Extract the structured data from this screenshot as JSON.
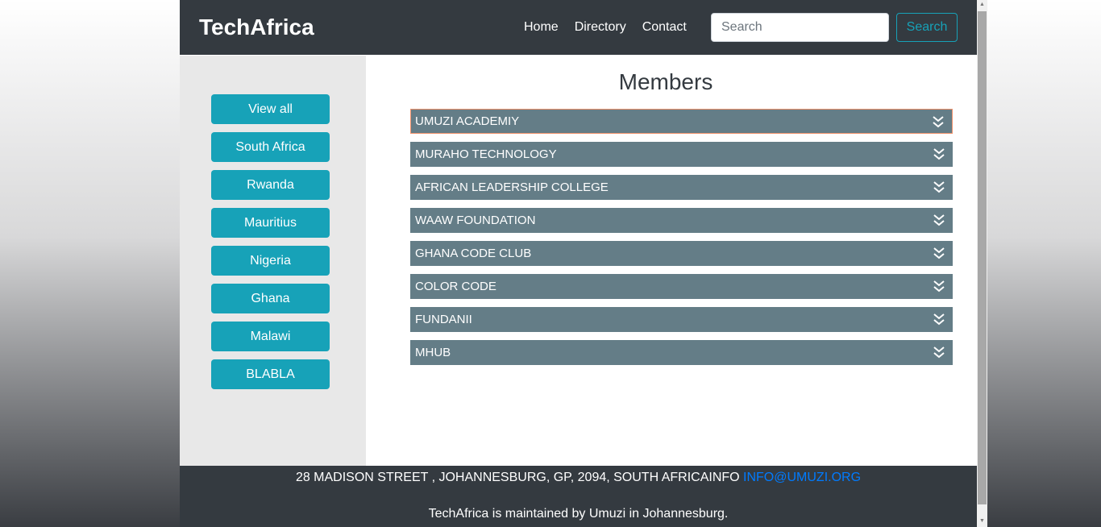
{
  "header": {
    "brand": "TechAfrica",
    "nav": [
      "Home",
      "Directory",
      "Contact"
    ],
    "search_placeholder": "Search",
    "search_button": "Search"
  },
  "sidebar": {
    "buttons": [
      "View all",
      "South Africa",
      "Rwanda",
      "Mauritius",
      "Nigeria",
      "Ghana",
      "Malawi",
      "BLABLA"
    ]
  },
  "main": {
    "title": "Members",
    "members": [
      "UMUZI ACADEMIY",
      "MURAHO TECHNOLOGY",
      "AFRICAN LEADERSHIP COLLEGE",
      "WAAW FOUNDATION",
      "GHANA CODE CLUB",
      "COLOR CODE",
      "FUNDANII",
      "MHUB"
    ],
    "member_icon": "double-chevron-down-icon"
  },
  "footer": {
    "address": "28 MADISON STREET , JOHANNESBURG, GP, 2094, SOUTH AFRICAINFO ",
    "email": "INFO@UMUZI.ORG",
    "maintained": "TechAfrica is maintained by Umuzi in Johannesburg."
  },
  "colors": {
    "nav": "#343a40",
    "accent": "#17a2b8",
    "member_bar": "#647d87",
    "sidebar": "#e8e8e8",
    "link": "#007bff"
  }
}
